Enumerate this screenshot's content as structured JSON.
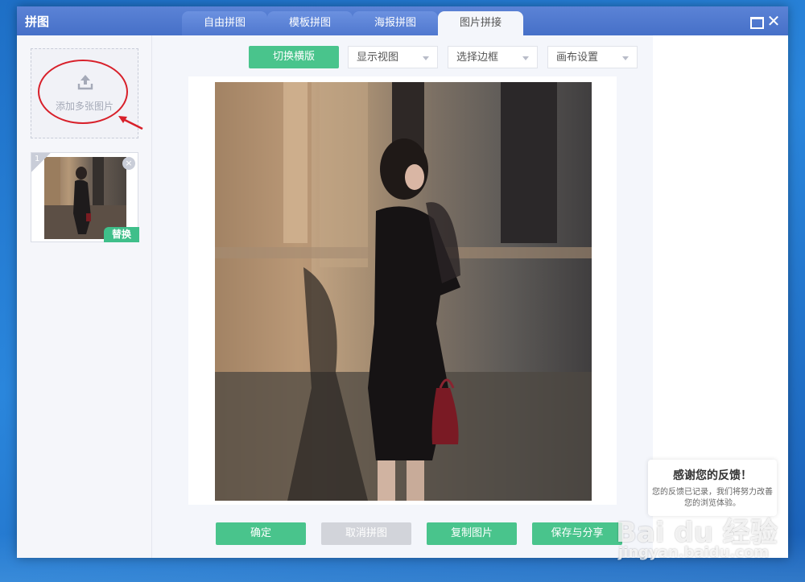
{
  "window": {
    "title": "拼图",
    "tabs": [
      {
        "label": "自由拼图",
        "active": false
      },
      {
        "label": "模板拼图",
        "active": false
      },
      {
        "label": "海报拼图",
        "active": false
      },
      {
        "label": "图片拼接",
        "active": true
      }
    ],
    "close_glyph": "✕"
  },
  "sidebar": {
    "add_label": "添加多张图片",
    "thumbnail": {
      "index": "1",
      "remove_glyph": "×",
      "replace_label": "替换"
    }
  },
  "toolbar": {
    "switch_label": "切换横版",
    "dropdowns": [
      {
        "label": "显示视图"
      },
      {
        "label": "选择边框"
      },
      {
        "label": "画布设置"
      }
    ]
  },
  "footer": {
    "confirm": "确定",
    "cancel": "取消拼图",
    "copy": "复制图片",
    "save_share": "保存与分享"
  },
  "feedback": {
    "title": "感谢您的反馈！",
    "text": "您的反馈已记录，我们将努力改善您的浏览体验。"
  },
  "watermark": {
    "logo": "Bai du 经验",
    "url": "jingyan.baidu.com"
  },
  "colors": {
    "titlebar": "#4670c8",
    "accent_green": "#49c48c",
    "annotation_red": "#d8202a"
  }
}
